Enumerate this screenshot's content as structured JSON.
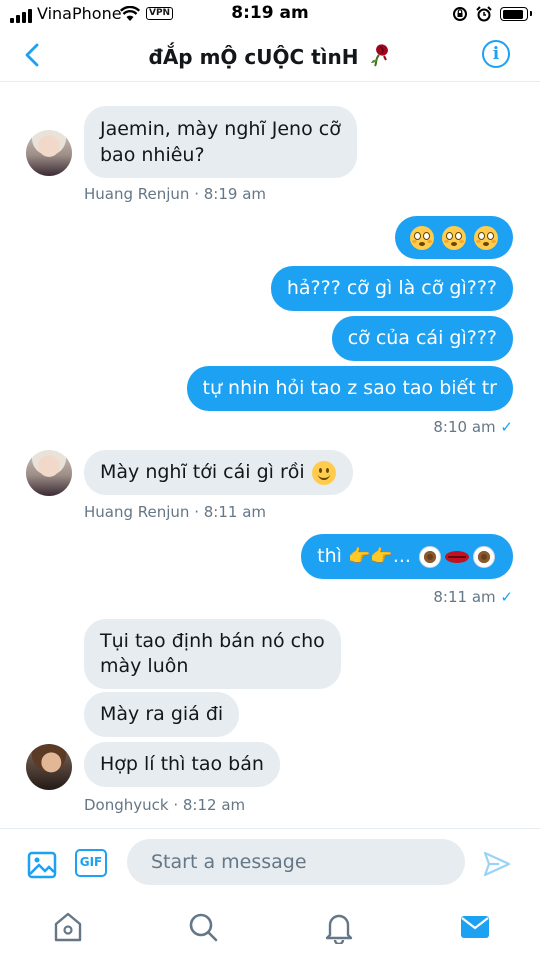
{
  "status_bar": {
    "carrier": "VinaPhone",
    "vpn": "VPN",
    "time": "8:19 am",
    "icons": [
      "signal-icon",
      "wifi-icon",
      "lock-rotation-icon",
      "alarm-icon",
      "battery-icon"
    ],
    "battery_level": 0.9
  },
  "header": {
    "title": "đẮp mỘ cUỘC tìnH",
    "title_emoji": "wilted-rose-icon",
    "info_label": "i"
  },
  "messages": [
    {
      "direction": "in",
      "lines": [
        "Jaemin, mày nghĩ Jeno cỡ",
        "bao nhiêu?"
      ]
    },
    {
      "meta": "Huang Renjun · 8:19 am"
    },
    {
      "direction": "out",
      "emoji": [
        "flushed-face-icon",
        "flushed-face-icon",
        "flushed-face-icon"
      ]
    },
    {
      "direction": "out",
      "text": "hả??? cỡ gì là cỡ gì???"
    },
    {
      "direction": "out",
      "text": "cỡ của cái gì???"
    },
    {
      "direction": "out",
      "text": "tự nhin hỏi tao z sao tao biết tr"
    },
    {
      "meta": "8:10 am",
      "check": "✓"
    },
    {
      "direction": "in",
      "text": "Mày nghĩ tới cái gì rồi",
      "emoji": [
        "slightly-smiling-face-icon"
      ]
    },
    {
      "meta": "Huang Renjun · 8:11 am"
    },
    {
      "direction": "out",
      "text": "thì",
      "suffix": "...",
      "emoji": [
        "pointing-right-icon",
        "pointing-right-icon",
        "eye-icon",
        "lips-icon",
        "eye-icon"
      ]
    },
    {
      "meta": "8:11 am",
      "check": "✓"
    },
    {
      "direction": "in",
      "lines": [
        "Tụi tao định bán nó cho",
        "mày luôn"
      ]
    },
    {
      "direction": "in",
      "text": "Mày ra giá đi"
    },
    {
      "direction": "in",
      "text": "Hợp lí thì tao bán"
    },
    {
      "meta": "Donghyuck · 8:12 am"
    }
  ],
  "composer": {
    "gif_label": "GIF",
    "placeholder": "Start a message"
  },
  "tabbar": [
    "home-icon",
    "search-icon",
    "notifications-icon",
    "messages-icon"
  ],
  "colors": {
    "accent": "#1da1f2",
    "incoming_bubble": "#e6ecf0",
    "meta_text": "#657786"
  }
}
